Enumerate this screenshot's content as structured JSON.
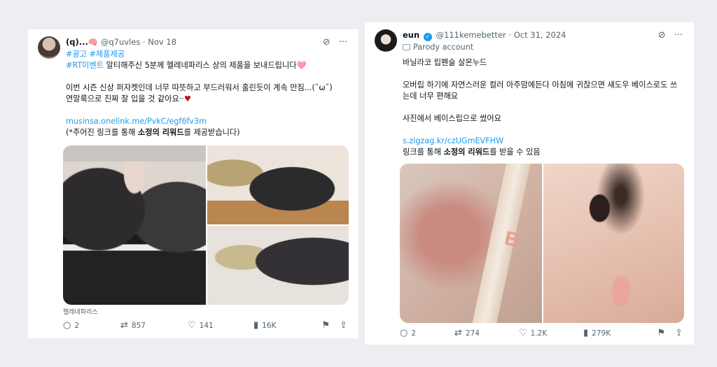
{
  "left_tweet": {
    "display_name": "(q)...",
    "name_emoji": "🧠",
    "handle": "@q7uvles",
    "dot": "·",
    "date": "Nov 18",
    "hashtags": "#광고 #제품제공",
    "line1_tag": "#RT이벤트",
    "line1_text": " 알티해주신 5분께 헬레네파리스 상의 제품을 보내드립니다",
    "line1_emoji": "🩷",
    "line2": "이번 시즌 신상 퍼자켓인데 너무 따뜻하고 부드러워서 홀린듯이 계속 만짐...(˘ω˘)",
    "line3": "연말룩으로 진짜 잘 입을 것 같아요··",
    "line3_emoji": "♥",
    "link": "musinsa.onelink.me/PvkC/egf6fv3m",
    "note_pre": "(*주어진 링크를 통해 ",
    "note_bold": "소정의 리워드",
    "note_post": "를 제공받습니다)",
    "media_caption": "헬레네파리스",
    "actions": {
      "replies": "2",
      "retweets": "857",
      "likes": "141",
      "views": "16K"
    }
  },
  "right_tweet": {
    "display_name": "eun",
    "verified_mark": "✓",
    "handle": "@111kemebetter",
    "dot": "·",
    "date": "Oct 31, 2024",
    "parody_label": "Parody account",
    "line1": "바닐라코 립펜슬 살몬누드",
    "line2": "오버립 하기에 자연스러운 컬러 아주맘에든다 아침에 귀찮으면 섀도우 베이스로도 쓰는데 너무 편해요",
    "line3": "사진에서 베이스립으로 썼어요",
    "link": "s.zigzag.kr/czUGmEVFHW",
    "note_pre": "링크를 통해 ",
    "note_bold": "소정의 리워드",
    "note_post": "를 받을 수 있음",
    "product_letter": "B",
    "actions": {
      "replies": "2",
      "retweets": "274",
      "likes": "1.2K",
      "views": "279K"
    }
  },
  "icons": {
    "grok": "⊘",
    "more": "···",
    "reply": "○",
    "retweet": "⇄",
    "like": "♡",
    "views": "▮",
    "bookmark": "⚑",
    "share": "⇪"
  }
}
